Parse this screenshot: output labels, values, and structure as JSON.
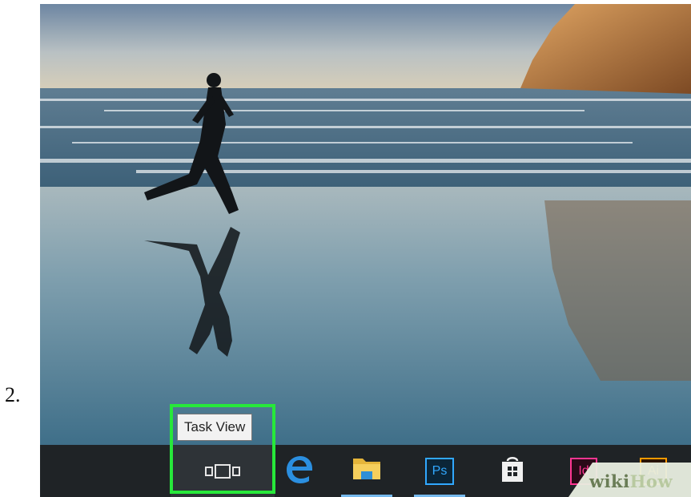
{
  "step": {
    "number": "2."
  },
  "tooltip": {
    "text": "Task View"
  },
  "taskbar": {
    "buttons": [
      {
        "name": "task-view",
        "icon": "task-view-icon"
      },
      {
        "name": "edge",
        "icon": "edge-icon"
      },
      {
        "name": "file-explorer",
        "icon": "folder-icon"
      },
      {
        "name": "photoshop",
        "icon": "photoshop-icon",
        "label": "Ps"
      },
      {
        "name": "store",
        "icon": "store-icon"
      },
      {
        "name": "indesign",
        "icon": "indesign-icon",
        "label": "Id"
      },
      {
        "name": "illustrator",
        "icon": "illustrator-icon",
        "label": "Ai"
      }
    ]
  },
  "watermark": {
    "part1": "wiki",
    "part2": "How"
  },
  "colors": {
    "highlight": "#27e83a",
    "taskbar": "#1f2326",
    "accent": "#76b9ed"
  }
}
